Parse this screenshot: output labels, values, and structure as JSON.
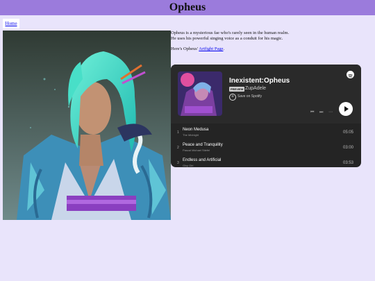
{
  "header": {
    "title": "Opheus"
  },
  "nav": {
    "home_label": "Home"
  },
  "bio": {
    "line1": "Opheus is a mysterious fae who's rarely seen in the human realm.",
    "line2": "He uses his powerful singing voice as a conduit for his magic.",
    "artfight_prefix": "Here's Opheus' ",
    "artfight_link": "Artfight Page",
    "artfight_suffix": "."
  },
  "player": {
    "album_title": "Inexistent:Opheus",
    "preview_badge": "PREVIEW",
    "artist": "ZupAdele",
    "save_label": "Save on Spotify",
    "tracks": [
      {
        "number": "1",
        "title": "Neon Medusa",
        "artist": "The Midnight",
        "duration": "05:05"
      },
      {
        "number": "2",
        "title": "Peace and Tranquility",
        "artist": "Pascal Michael Stiefel",
        "duration": "03:00"
      },
      {
        "number": "3",
        "title": "Endless and Artificial",
        "artist": "Glxy Girl",
        "duration": "03:53"
      }
    ]
  },
  "colors": {
    "header_bg": "#9b7bdc",
    "page_bg": "#e9e4fb",
    "player_bg": "#242424"
  }
}
